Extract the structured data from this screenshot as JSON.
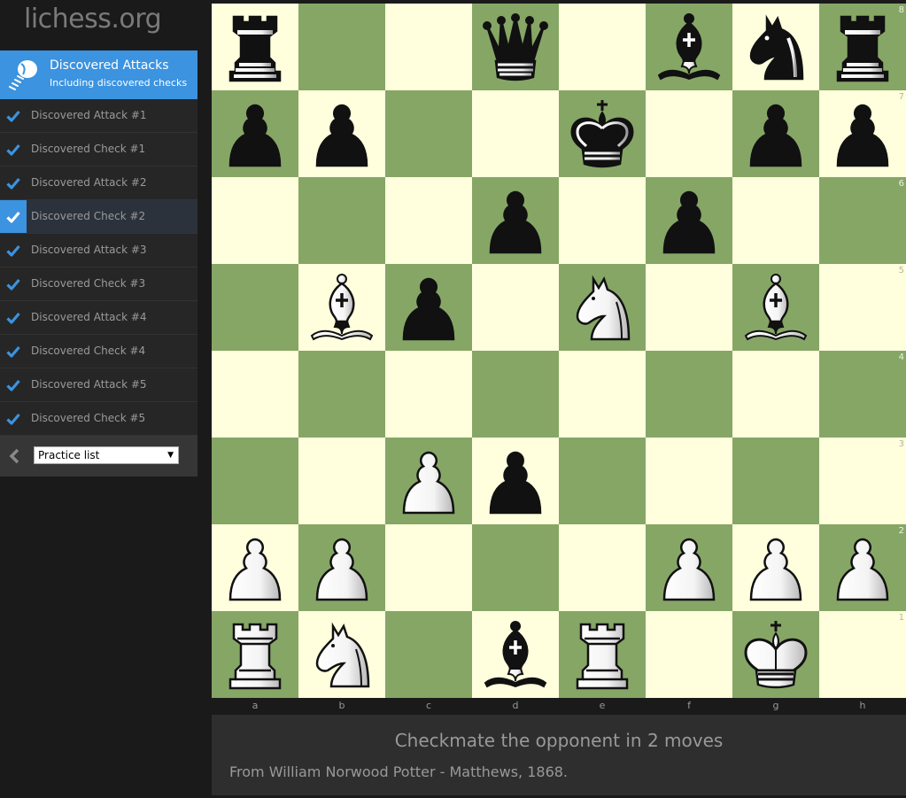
{
  "site": {
    "logo": "lichess.org"
  },
  "practice": {
    "title": "Discovered Attacks",
    "subtitle": "Including discovered checks",
    "icon": "practice-bulb-icon",
    "stages": [
      {
        "label": "Discovered Attack #1",
        "done": true,
        "active": false
      },
      {
        "label": "Discovered Check #1",
        "done": true,
        "active": false
      },
      {
        "label": "Discovered Attack #2",
        "done": true,
        "active": false
      },
      {
        "label": "Discovered Check #2",
        "done": true,
        "active": true
      },
      {
        "label": "Discovered Attack #3",
        "done": true,
        "active": false
      },
      {
        "label": "Discovered Check #3",
        "done": true,
        "active": false
      },
      {
        "label": "Discovered Attack #4",
        "done": true,
        "active": false
      },
      {
        "label": "Discovered Check #4",
        "done": true,
        "active": false
      },
      {
        "label": "Discovered Attack #5",
        "done": true,
        "active": false
      },
      {
        "label": "Discovered Check #5",
        "done": true,
        "active": false
      }
    ],
    "footer": {
      "back_icon": "chevron-left-icon",
      "select_value": "Practice list"
    }
  },
  "board": {
    "orientation": "white",
    "colors": {
      "light": "#ffffdd",
      "dark": "#86a666",
      "accent": "#3c93e0"
    },
    "files": [
      "a",
      "b",
      "c",
      "d",
      "e",
      "f",
      "g",
      "h"
    ],
    "ranks": [
      "8",
      "7",
      "6",
      "5",
      "4",
      "3",
      "2",
      "1"
    ],
    "position": [
      [
        "br",
        "",
        "",
        "bq",
        "",
        "bb",
        "bn",
        "br"
      ],
      [
        "bp",
        "bp",
        "",
        "",
        "bk",
        "",
        "bp",
        "bp"
      ],
      [
        "",
        "",
        "",
        "bp",
        "",
        "bp",
        "",
        ""
      ],
      [
        "",
        "wb",
        "bp",
        "",
        "wn",
        "",
        "wb",
        ""
      ],
      [
        "",
        "",
        "",
        "",
        "",
        "",
        "",
        ""
      ],
      [
        "",
        "",
        "wp",
        "bp",
        "",
        "",
        "",
        ""
      ],
      [
        "wp",
        "wp",
        "",
        "",
        "",
        "wp",
        "wp",
        "wp"
      ],
      [
        "wr",
        "wn",
        "",
        "bb",
        "wr",
        "",
        "wk",
        ""
      ]
    ]
  },
  "info": {
    "goal": "Checkmate the opponent in 2 moves",
    "source": "From William Norwood Potter - Matthews, 1868."
  }
}
